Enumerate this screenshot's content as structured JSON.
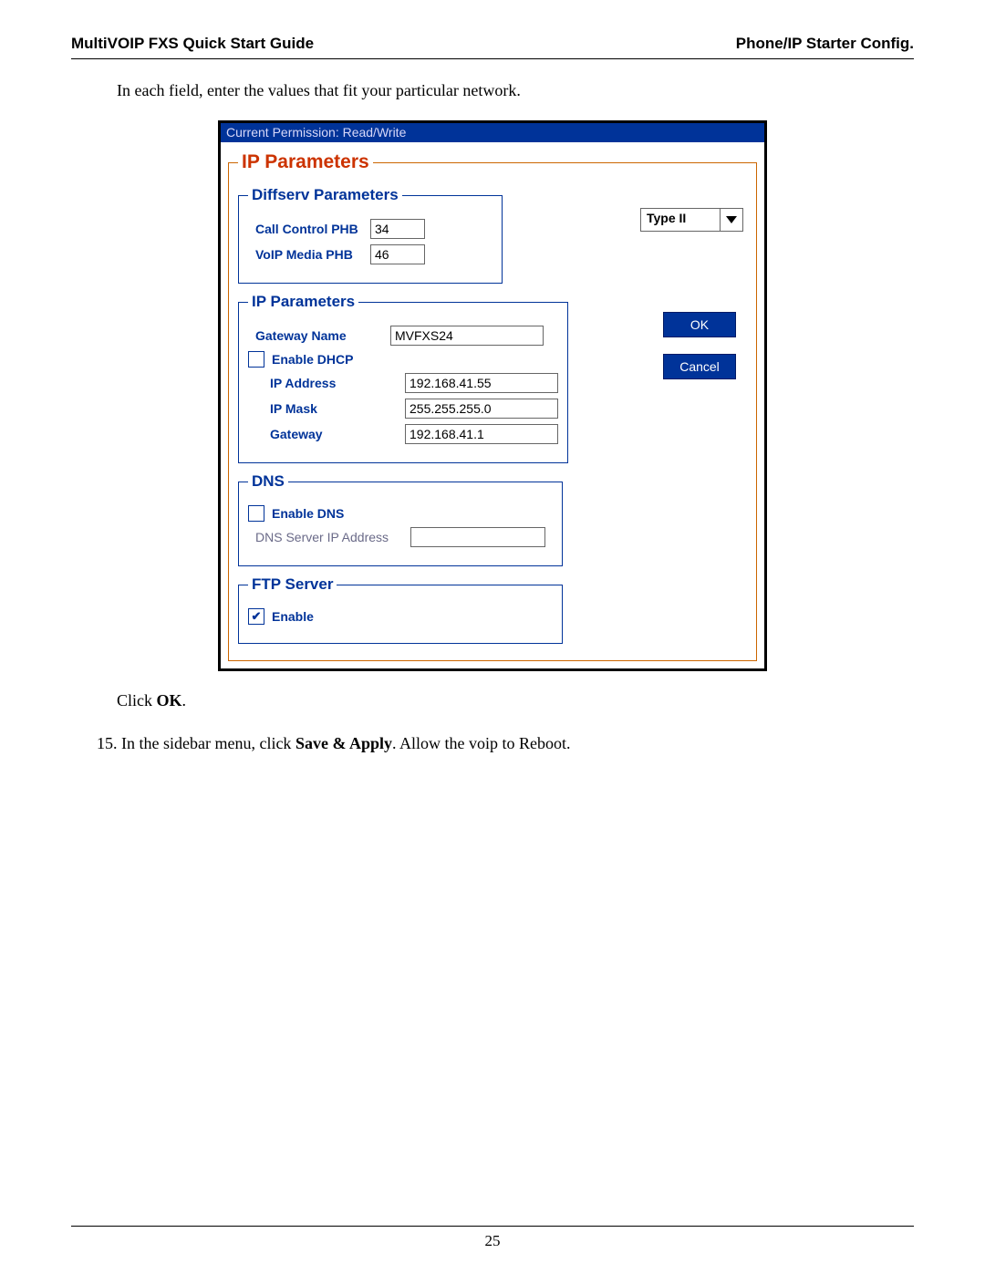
{
  "header": {
    "left": "MultiVOIP FXS Quick Start Guide",
    "right": "Phone/IP Starter Config."
  },
  "intro": "In each field, enter the values that fit  your particular network.",
  "screenshot": {
    "statusbar": "Current Permission: Read/Write",
    "outer_legend": "IP Parameters",
    "type_dropdown": {
      "value": "Type II"
    },
    "diffserv": {
      "legend": "Diffserv Parameters",
      "call_control_label": "Call Control PHB",
      "call_control_value": "34",
      "voip_media_label": "VoIP Media PHB",
      "voip_media_value": "46"
    },
    "ip": {
      "legend": "IP Parameters",
      "gateway_name_label": "Gateway Name",
      "gateway_name_value": "MVFXS24",
      "enable_dhcp_label": "Enable DHCP",
      "enable_dhcp_checked": false,
      "ip_address_label": "IP Address",
      "ip_address_value": "192.168.41.55",
      "ip_mask_label": "IP Mask",
      "ip_mask_value": "255.255.255.0",
      "gateway_label": "Gateway",
      "gateway_value": "192.168.41.1"
    },
    "dns": {
      "legend": "DNS",
      "enable_dns_label": "Enable DNS",
      "enable_dns_checked": false,
      "dns_server_label": "DNS Server IP Address",
      "dns_server_value": ""
    },
    "ftp": {
      "legend": "FTP Server",
      "enable_label": "Enable",
      "enable_checked": true
    },
    "buttons": {
      "ok": "OK",
      "cancel": "Cancel"
    }
  },
  "after": {
    "click_prefix": "Click ",
    "click_bold": "OK",
    "click_suffix": "."
  },
  "step15": {
    "num": "15.",
    "prefix": "  In the sidebar menu, click ",
    "bold": "Save & Apply",
    "suffix": ".  Allow the voip to Reboot."
  },
  "page_number": "25"
}
